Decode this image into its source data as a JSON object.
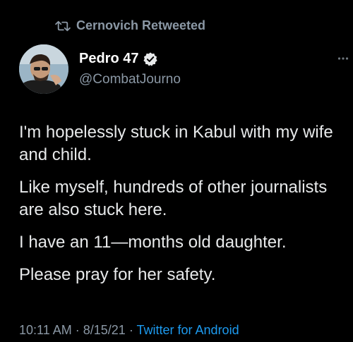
{
  "retweet": {
    "label": "Cernovich Retweeted",
    "icon": "retweet-icon"
  },
  "author": {
    "name": "Pedro 47",
    "handle": "@CombatJourno",
    "verified": true,
    "avatar": "avatar"
  },
  "tweet": {
    "paragraphs": [
      "I'm hopelessly stuck in Kabul with my wife and child.",
      "Like myself, hundreds of other journalists are also stuck here.",
      "I have an 11—months old daughter.",
      "Please pray for her safety."
    ],
    "time": "10:11 AM",
    "date": "8/15/21",
    "separator": "·",
    "source": "Twitter for Android"
  },
  "colors": {
    "background": "#000000",
    "text": "#e7e9ea",
    "muted": "#8b98a5",
    "link": "#1d9bf0"
  },
  "icons": {
    "more": "more-icon",
    "verified": "verified-icon"
  }
}
